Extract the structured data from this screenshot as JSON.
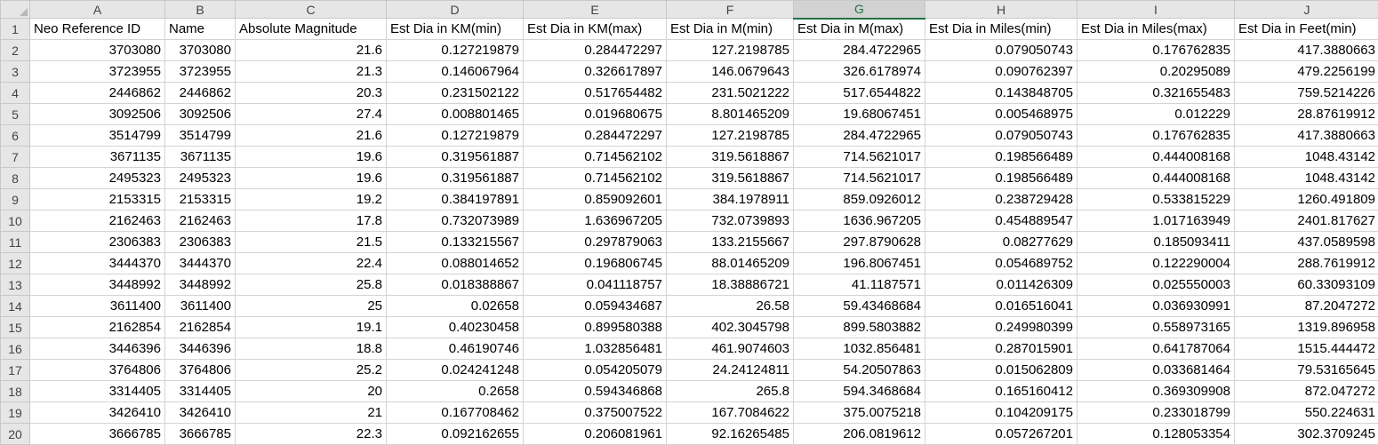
{
  "columns": [
    "A",
    "B",
    "C",
    "D",
    "E",
    "F",
    "G",
    "H",
    "I",
    "J"
  ],
  "selected_column": "G",
  "rows": [
    {
      "num": "1",
      "cells": [
        "Neo Reference ID",
        "Name",
        "Absolute Magnitude",
        "Est Dia in KM(min)",
        "Est Dia in KM(max)",
        "Est Dia in M(min)",
        "Est Dia in M(max)",
        "Est Dia in Miles(min)",
        "Est Dia in Miles(max)",
        "Est Dia in Feet(min)"
      ]
    },
    {
      "num": "2",
      "cells": [
        "3703080",
        "3703080",
        "21.6",
        "0.127219879",
        "0.284472297",
        "127.2198785",
        "284.4722965",
        "0.079050743",
        "0.176762835",
        "417.3880663"
      ]
    },
    {
      "num": "3",
      "cells": [
        "3723955",
        "3723955",
        "21.3",
        "0.146067964",
        "0.326617897",
        "146.0679643",
        "326.6178974",
        "0.090762397",
        "0.20295089",
        "479.2256199"
      ]
    },
    {
      "num": "4",
      "cells": [
        "2446862",
        "2446862",
        "20.3",
        "0.231502122",
        "0.517654482",
        "231.5021222",
        "517.6544822",
        "0.143848705",
        "0.321655483",
        "759.5214226"
      ]
    },
    {
      "num": "5",
      "cells": [
        "3092506",
        "3092506",
        "27.4",
        "0.008801465",
        "0.019680675",
        "8.801465209",
        "19.68067451",
        "0.005468975",
        "0.012229",
        "28.87619912"
      ]
    },
    {
      "num": "6",
      "cells": [
        "3514799",
        "3514799",
        "21.6",
        "0.127219879",
        "0.284472297",
        "127.2198785",
        "284.4722965",
        "0.079050743",
        "0.176762835",
        "417.3880663"
      ]
    },
    {
      "num": "7",
      "cells": [
        "3671135",
        "3671135",
        "19.6",
        "0.319561887",
        "0.714562102",
        "319.5618867",
        "714.5621017",
        "0.198566489",
        "0.444008168",
        "1048.43142"
      ]
    },
    {
      "num": "8",
      "cells": [
        "2495323",
        "2495323",
        "19.6",
        "0.319561887",
        "0.714562102",
        "319.5618867",
        "714.5621017",
        "0.198566489",
        "0.444008168",
        "1048.43142"
      ]
    },
    {
      "num": "9",
      "cells": [
        "2153315",
        "2153315",
        "19.2",
        "0.384197891",
        "0.859092601",
        "384.1978911",
        "859.0926012",
        "0.238729428",
        "0.533815229",
        "1260.491809"
      ]
    },
    {
      "num": "10",
      "cells": [
        "2162463",
        "2162463",
        "17.8",
        "0.732073989",
        "1.636967205",
        "732.0739893",
        "1636.967205",
        "0.454889547",
        "1.017163949",
        "2401.817627"
      ]
    },
    {
      "num": "11",
      "cells": [
        "2306383",
        "2306383",
        "21.5",
        "0.133215567",
        "0.297879063",
        "133.2155667",
        "297.8790628",
        "0.08277629",
        "0.185093411",
        "437.0589598"
      ]
    },
    {
      "num": "12",
      "cells": [
        "3444370",
        "3444370",
        "22.4",
        "0.088014652",
        "0.196806745",
        "88.01465209",
        "196.8067451",
        "0.054689752",
        "0.122290004",
        "288.7619912"
      ]
    },
    {
      "num": "13",
      "cells": [
        "3448992",
        "3448992",
        "25.8",
        "0.018388867",
        "0.041118757",
        "18.38886721",
        "41.1187571",
        "0.011426309",
        "0.025550003",
        "60.33093109"
      ]
    },
    {
      "num": "14",
      "cells": [
        "3611400",
        "3611400",
        "25",
        "0.02658",
        "0.059434687",
        "26.58",
        "59.43468684",
        "0.016516041",
        "0.036930991",
        "87.2047272"
      ]
    },
    {
      "num": "15",
      "cells": [
        "2162854",
        "2162854",
        "19.1",
        "0.40230458",
        "0.899580388",
        "402.3045798",
        "899.5803882",
        "0.249980399",
        "0.558973165",
        "1319.896958"
      ]
    },
    {
      "num": "16",
      "cells": [
        "3446396",
        "3446396",
        "18.8",
        "0.46190746",
        "1.032856481",
        "461.9074603",
        "1032.856481",
        "0.287015901",
        "0.641787064",
        "1515.444472"
      ]
    },
    {
      "num": "17",
      "cells": [
        "3764806",
        "3764806",
        "25.2",
        "0.024241248",
        "0.054205079",
        "24.24124811",
        "54.20507863",
        "0.015062809",
        "0.033681464",
        "79.53165645"
      ]
    },
    {
      "num": "18",
      "cells": [
        "3314405",
        "3314405",
        "20",
        "0.2658",
        "0.594346868",
        "265.8",
        "594.3468684",
        "0.165160412",
        "0.369309908",
        "872.047272"
      ]
    },
    {
      "num": "19",
      "cells": [
        "3426410",
        "3426410",
        "21",
        "0.167708462",
        "0.375007522",
        "167.7084622",
        "375.0075218",
        "0.104209175",
        "0.233018799",
        "550.224631"
      ]
    },
    {
      "num": "20",
      "cells": [
        "3666785",
        "3666785",
        "22.3",
        "0.092162655",
        "0.206081961",
        "92.16265485",
        "206.0819612",
        "0.057267201",
        "0.128053354",
        "302.3709245"
      ]
    }
  ]
}
